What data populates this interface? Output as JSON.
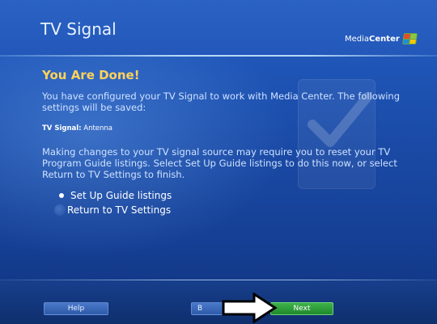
{
  "header": {
    "title": "TV Signal",
    "logo_text_a": "Media",
    "logo_text_b": "Center"
  },
  "content": {
    "heading": "You Are Done!",
    "intro": "You have configured your TV Signal to work with Media Center. The following settings will be saved:",
    "signal_label": "TV Signal:",
    "signal_value": " Antenna",
    "instructions": "Making changes to your TV signal source may require you to reset your TV Program Guide listings. Select Set Up Guide listings to do this now, or select Return to TV Settings to finish."
  },
  "options": [
    {
      "label": "Set Up Guide listings",
      "selected": true
    },
    {
      "label": "Return to TV Settings",
      "selected": false
    }
  ],
  "footer": {
    "help_label": "Help",
    "back_label": "B",
    "next_label": "Next"
  },
  "colors": {
    "heading": "#ffd25a",
    "background": "#1a4aa6",
    "next_button": "#2aa13a"
  },
  "icons": [
    "checkmark-watermark-icon",
    "windows-flag-icon",
    "white-arrow-pointer"
  ]
}
